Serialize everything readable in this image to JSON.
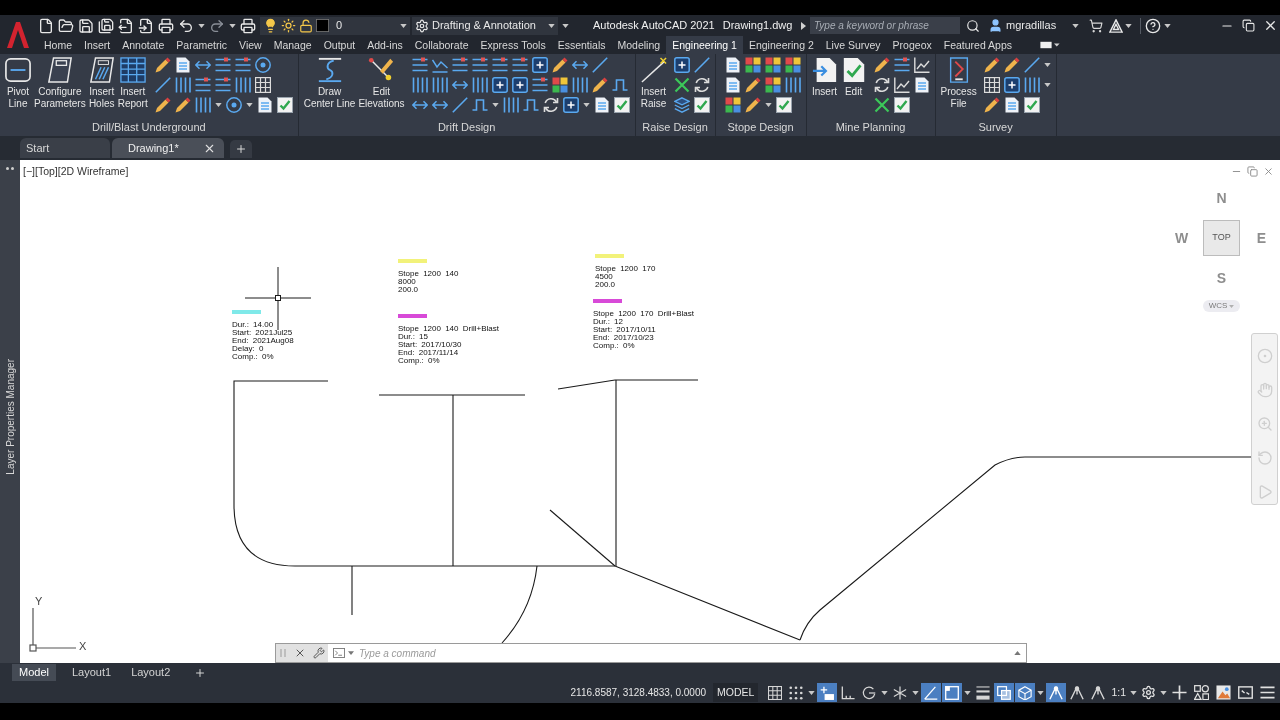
{
  "quick_access": {
    "layer": "0",
    "workspace": "Drafting & Annotation"
  },
  "title": {
    "app": "Autodesk AutoCAD 2021",
    "file": "Drawing1.dwg"
  },
  "search": {
    "placeholder": "Type a keyword or phrase"
  },
  "user": {
    "name": "mgradillas"
  },
  "ribbon_tabs": [
    {
      "label": "Home",
      "selected": false
    },
    {
      "label": "Insert",
      "selected": false
    },
    {
      "label": "Annotate",
      "selected": false
    },
    {
      "label": "Parametric",
      "selected": false
    },
    {
      "label": "View",
      "selected": false
    },
    {
      "label": "Manage",
      "selected": false
    },
    {
      "label": "Output",
      "selected": false
    },
    {
      "label": "Add-ins",
      "selected": false
    },
    {
      "label": "Collaborate",
      "selected": false
    },
    {
      "label": "Express Tools",
      "selected": false
    },
    {
      "label": "Essentials",
      "selected": false
    },
    {
      "label": "Modeling",
      "selected": false
    },
    {
      "label": "Engineering 1",
      "selected": true
    },
    {
      "label": "Engineering 2",
      "selected": false
    },
    {
      "label": "Live Survey",
      "selected": false
    },
    {
      "label": "Progeox",
      "selected": false
    },
    {
      "label": "Featured Apps",
      "selected": false
    }
  ],
  "ribbon_panels": [
    {
      "title": "Drill/Blast Underground",
      "buttons": [
        {
          "label": "Pivot\nLine"
        },
        {
          "label": "Configure\nParameters"
        },
        {
          "label": "Insert\nHoles"
        },
        {
          "label": "Insert\nReport"
        }
      ]
    },
    {
      "title": "Drift Design",
      "buttons": [
        {
          "label": "Draw\nCenter Line"
        },
        {
          "label": "Edit\nElevations"
        }
      ]
    },
    {
      "title": "Raise Design",
      "buttons": [
        {
          "label": "Insert\nRaise"
        }
      ]
    },
    {
      "title": "Stope Design"
    },
    {
      "title": "Mine Planning",
      "buttons": [
        {
          "label": "Insert"
        },
        {
          "label": "Edit"
        }
      ]
    },
    {
      "title": "Survey",
      "buttons": [
        {
          "label": "Process\nFile"
        }
      ]
    }
  ],
  "file_tabs": [
    {
      "label": "Start",
      "selected": false
    },
    {
      "label": "Drawing1*",
      "selected": true
    }
  ],
  "palette": {
    "title": "Layer Properties Manager"
  },
  "viewport": {
    "label": "[−][Top][2D Wireframe]"
  },
  "viewcube": {
    "north": "N",
    "west": "W",
    "top": "TOP",
    "east": "E",
    "south": "S",
    "coordinate_system": "WCS"
  },
  "annotations": [
    {
      "color": "#7fe9e9",
      "lines": [
        "Dur.: 14.00",
        "Start: 2021Jul25",
        "End: 2021Aug08",
        "Delay: 0",
        "Comp.: 0%"
      ]
    },
    {
      "color": "#f2f27a",
      "lines": [
        "Stope 1200 140",
        "8000",
        "200.0"
      ]
    },
    {
      "color": "#d84ad8",
      "lines": [
        "Stope 1200 140 Drill+Blast",
        "Dur.: 15",
        "Start: 2017/10/30",
        "End: 2017/11/14",
        "Comp.: 0%"
      ]
    },
    {
      "color": "#f2f27a",
      "lines": [
        "Stope 1200 170",
        "4500",
        "200.0"
      ]
    },
    {
      "color": "#d84ad8",
      "lines": [
        "Stope 1200 170 Drill+Blast",
        "Dur.: 12",
        "Start: 2017/10/11",
        "End: 2017/10/23",
        "Comp.: 0%"
      ]
    }
  ],
  "ucs": {
    "x_label": "X",
    "y_label": "Y"
  },
  "command_line": {
    "placeholder": "Type a command"
  },
  "layout_tabs": [
    {
      "label": "Model",
      "selected": true
    },
    {
      "label": "Layout1",
      "selected": false
    },
    {
      "label": "Layout2",
      "selected": false
    }
  ],
  "status_bar": {
    "coordinates": "2116.8587, 3128.4833, 0.0000",
    "space": "MODEL",
    "annotation_scale": "1:1",
    "toggles": [
      {
        "on": false
      },
      {
        "on": false
      },
      {
        "on": true
      },
      {
        "on": false
      },
      {
        "on": false
      },
      {
        "on": false
      },
      {
        "on": true
      },
      {
        "on": true
      },
      {
        "on": false
      },
      {
        "on": true
      },
      {
        "on": true
      },
      {
        "on": true
      },
      {
        "on": false
      },
      {
        "on": false
      }
    ]
  }
}
